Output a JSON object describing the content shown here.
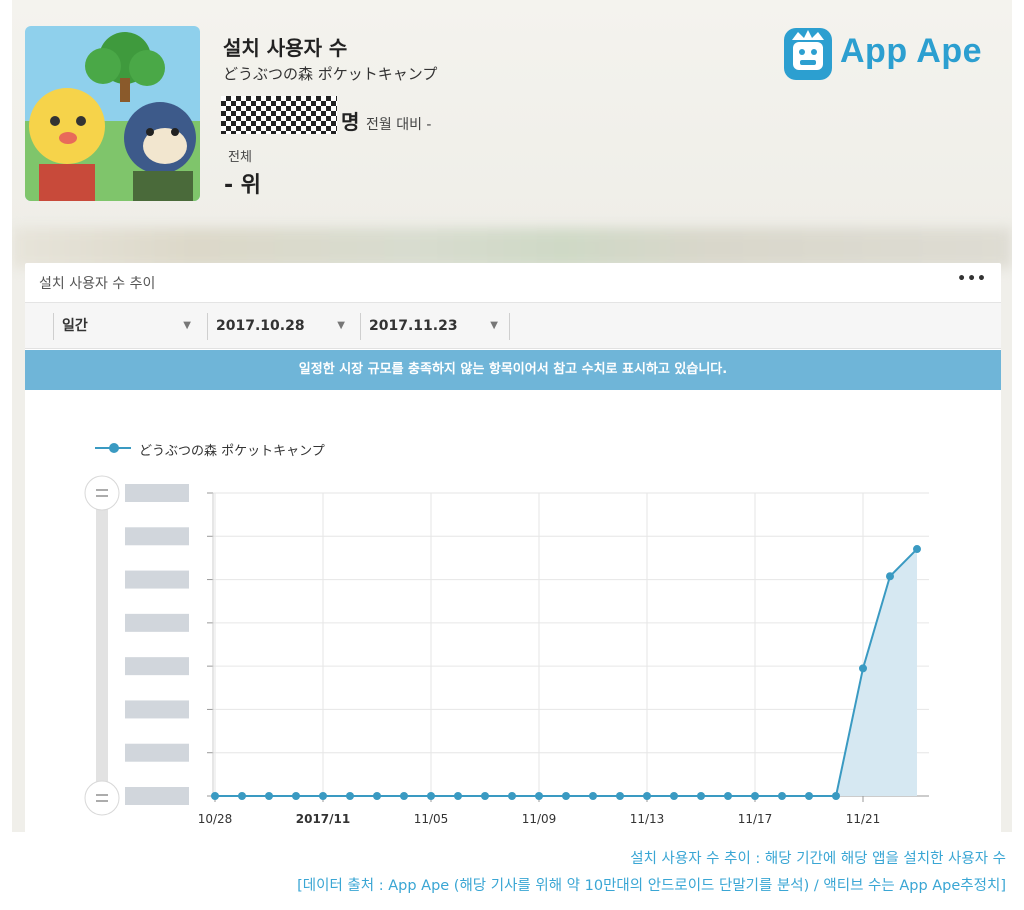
{
  "header": {
    "title": "설치 사용자 수",
    "app_name": "どうぶつの森 ポケットキャンプ",
    "unit": "명",
    "month_over_month": "전월 대비 -",
    "total_label": "전체",
    "rank": "- 위"
  },
  "brand": {
    "name": "App Ape",
    "color": "#2c9fd0"
  },
  "card": {
    "title": "설치 사용자 수 추이",
    "menu_icon": "more-horizontal-icon",
    "filters": {
      "period": "일간",
      "start_date": "2017.10.28",
      "end_date": "2017.11.23"
    },
    "notice": "일정한 시장 규모를 충족하지 않는 항목이어서 참고 수치로 표시하고 있습니다."
  },
  "chart_data": {
    "type": "line",
    "title": "",
    "xlabel": "",
    "ylabel": "",
    "legend": [
      "どうぶつの森 ポケットキャンプ"
    ],
    "legend_position": "top-left",
    "grid": true,
    "x_tick_labels": [
      "10/28",
      "2017/11",
      "11/05",
      "11/09",
      "11/13",
      "11/17",
      "11/21"
    ],
    "x_tick_index": [
      0,
      4,
      8,
      12,
      16,
      20,
      24
    ],
    "ylim": [
      0,
      7
    ],
    "y_tick_count": 8,
    "series": [
      {
        "name": "どうぶつの森 ポケットキャンプ",
        "color": "#3a9ac2",
        "fill": "#d6e8f2",
        "values": [
          0,
          0,
          0,
          0,
          0,
          0,
          0,
          0,
          0,
          0,
          0,
          0,
          0,
          0,
          0,
          0,
          0,
          0,
          0,
          0,
          0,
          0,
          0,
          0,
          3.05,
          5.25,
          5.9
        ]
      }
    ]
  },
  "caption": {
    "line1": "설치 사용자 수 추이 : 해당 기간에 해당 앱을 설치한 사용자 수",
    "line2": "[데이터 출처 : App Ape (해당 기사를 위해 약 10만대의 안드로이드 단말기를 분석) / 액티브 수는 App Ape추정치]"
  }
}
